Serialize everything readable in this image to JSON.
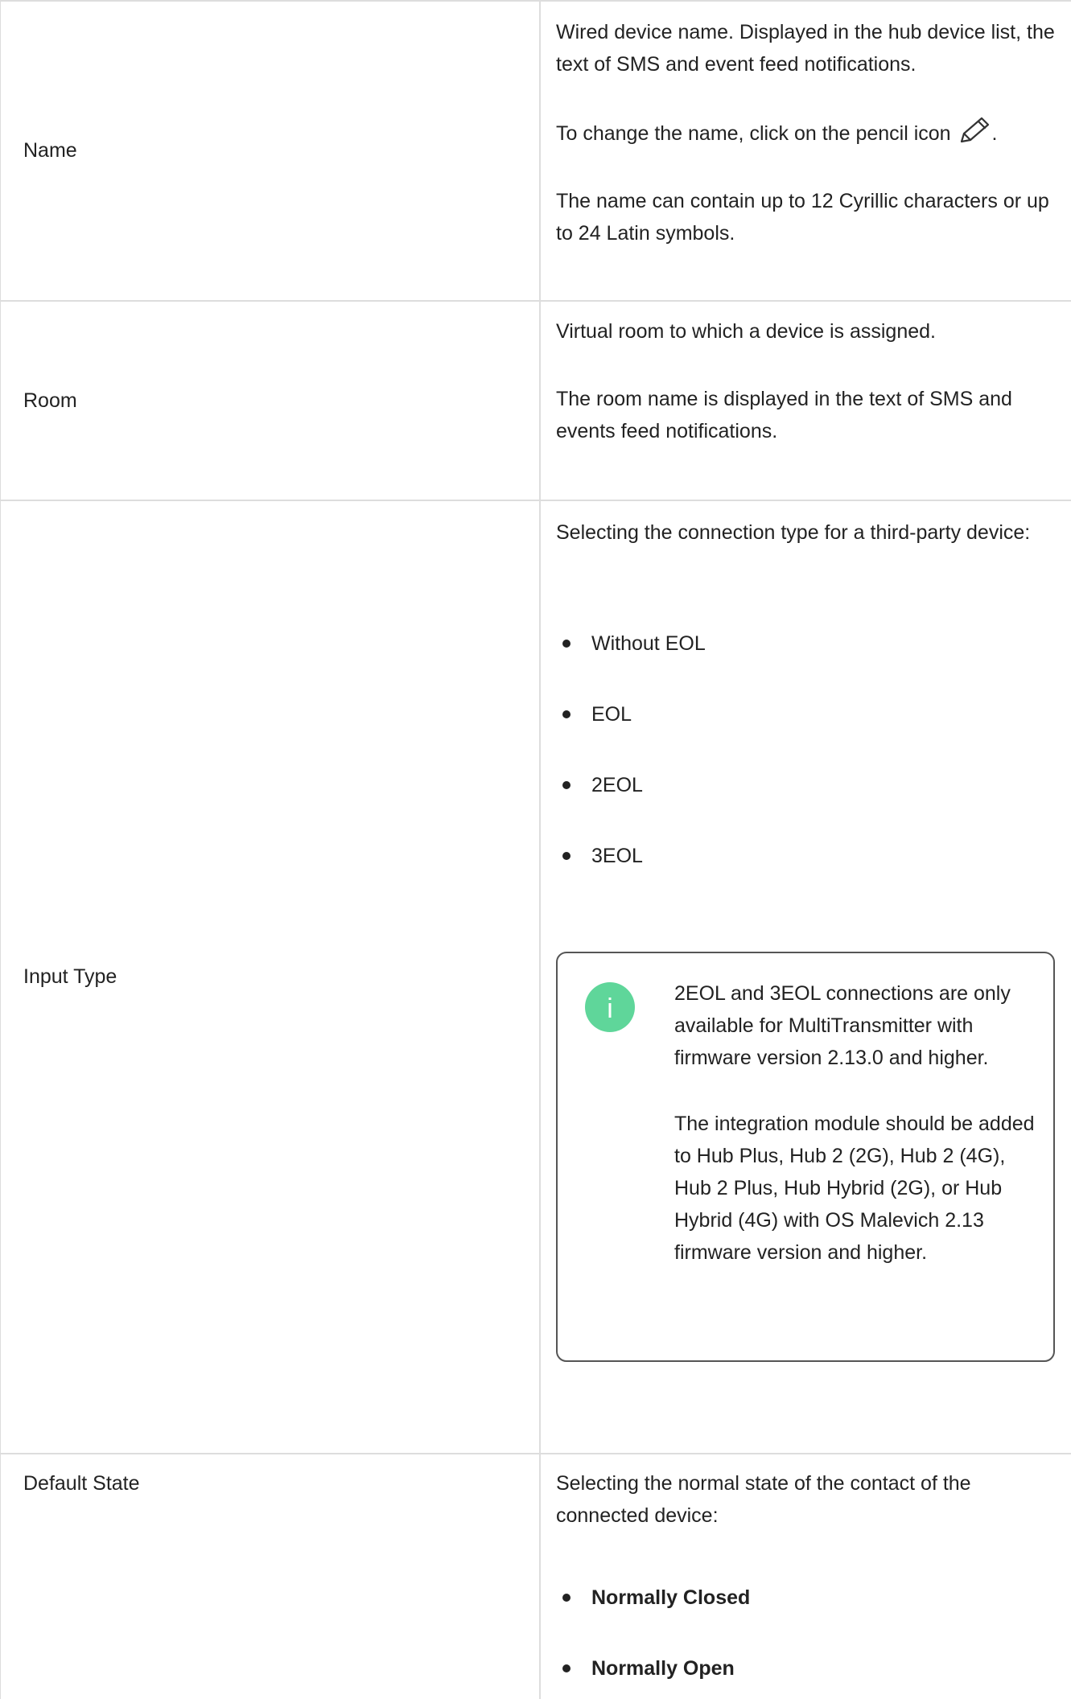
{
  "rows": {
    "name": {
      "label": "Name",
      "desc_1": "Wired device name. Displayed in the hub device list, the text of SMS and event feed notifications.",
      "desc_2_before": "To change the name, click on the pencil icon",
      "desc_2_after": ".",
      "desc_3": "The name can contain up to 12 Cyrillic characters or up to 24 Latin symbols."
    },
    "room": {
      "label": "Room",
      "desc_1": "Virtual room to which a device is assigned.",
      "desc_2": "The room name is displayed in the text of SMS and events feed notifications."
    },
    "input_type": {
      "label": "Input Type",
      "desc_1": "Selecting the connection type for a third-party device:",
      "options": [
        "Without EOL",
        "EOL",
        "2EOL",
        "3EOL"
      ],
      "note": {
        "icon": "info-icon",
        "color": "#5fd69a",
        "text_1": "2EOL and 3EOL connections are only available for MultiTransmitter with firmware version 2.13.0 and higher.",
        "text_2": "The integration module should be added to Hub Plus, Hub 2 (2G), Hub 2 (4G), Hub 2 Plus, Hub Hybrid (2G), or Hub Hybrid (4G) with OS Malevich 2.13 firmware version and higher."
      }
    },
    "default_state": {
      "label": "Default State",
      "desc_1": "Selecting the normal state of the contact of the connected device:",
      "options": [
        "Normally Closed",
        "Normally Open"
      ]
    }
  }
}
